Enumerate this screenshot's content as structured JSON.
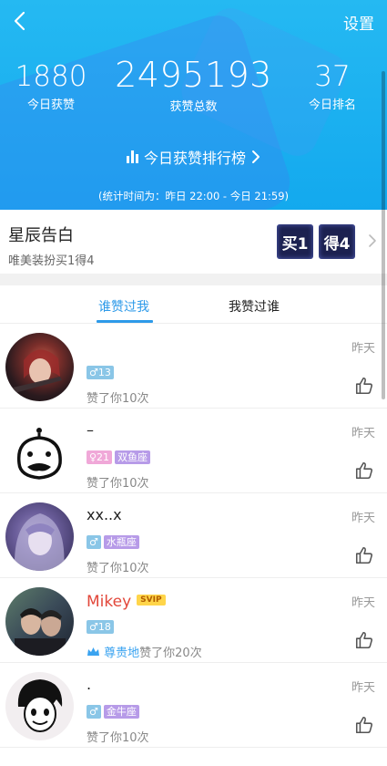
{
  "header": {
    "settings_label": "设置",
    "today_likes": "1880",
    "today_likes_label": "今日获赞",
    "total_likes": "2495193",
    "total_likes_label": "获赞总数",
    "today_rank": "37",
    "today_rank_label": "今日排名",
    "rank_link_label": "今日获赞排行榜",
    "stats_period": "(统计时间为：昨日 22:00 - 今日 21:59)"
  },
  "promo": {
    "title": "星辰告白",
    "subtitle": "唯美装扮买1得4",
    "tile1": "买1",
    "tile2": "得4"
  },
  "tabs": [
    {
      "label": "谁赞过我",
      "active": true
    },
    {
      "label": "我赞过谁",
      "active": false
    }
  ],
  "list": [
    {
      "name": "",
      "tags": [
        "♂13"
      ],
      "liked_prefix": "",
      "liked": "赞了你10次",
      "time": "昨天"
    },
    {
      "name": "–",
      "tags": [
        "♀21",
        "双鱼座"
      ],
      "liked_prefix": "",
      "liked": "赞了你10次",
      "time": "昨天"
    },
    {
      "name": "xx..x",
      "tags": [
        "♂",
        "水瓶座"
      ],
      "liked_prefix": "",
      "liked": "赞了你10次",
      "time": "昨天"
    },
    {
      "name": "Mikey",
      "badge": "SVIP",
      "tags": [
        "♂18"
      ],
      "liked_prefix": "尊贵地",
      "liked": "赞了你20次",
      "time": "昨天"
    },
    {
      "name": ".",
      "tags": [
        "♂",
        "金牛座"
      ],
      "liked_prefix": "",
      "liked": "赞了你10次",
      "time": "昨天"
    }
  ],
  "colors": {
    "accent": "#2d9ae9",
    "header": "#1aaef0",
    "vip_name": "#e2473a"
  }
}
